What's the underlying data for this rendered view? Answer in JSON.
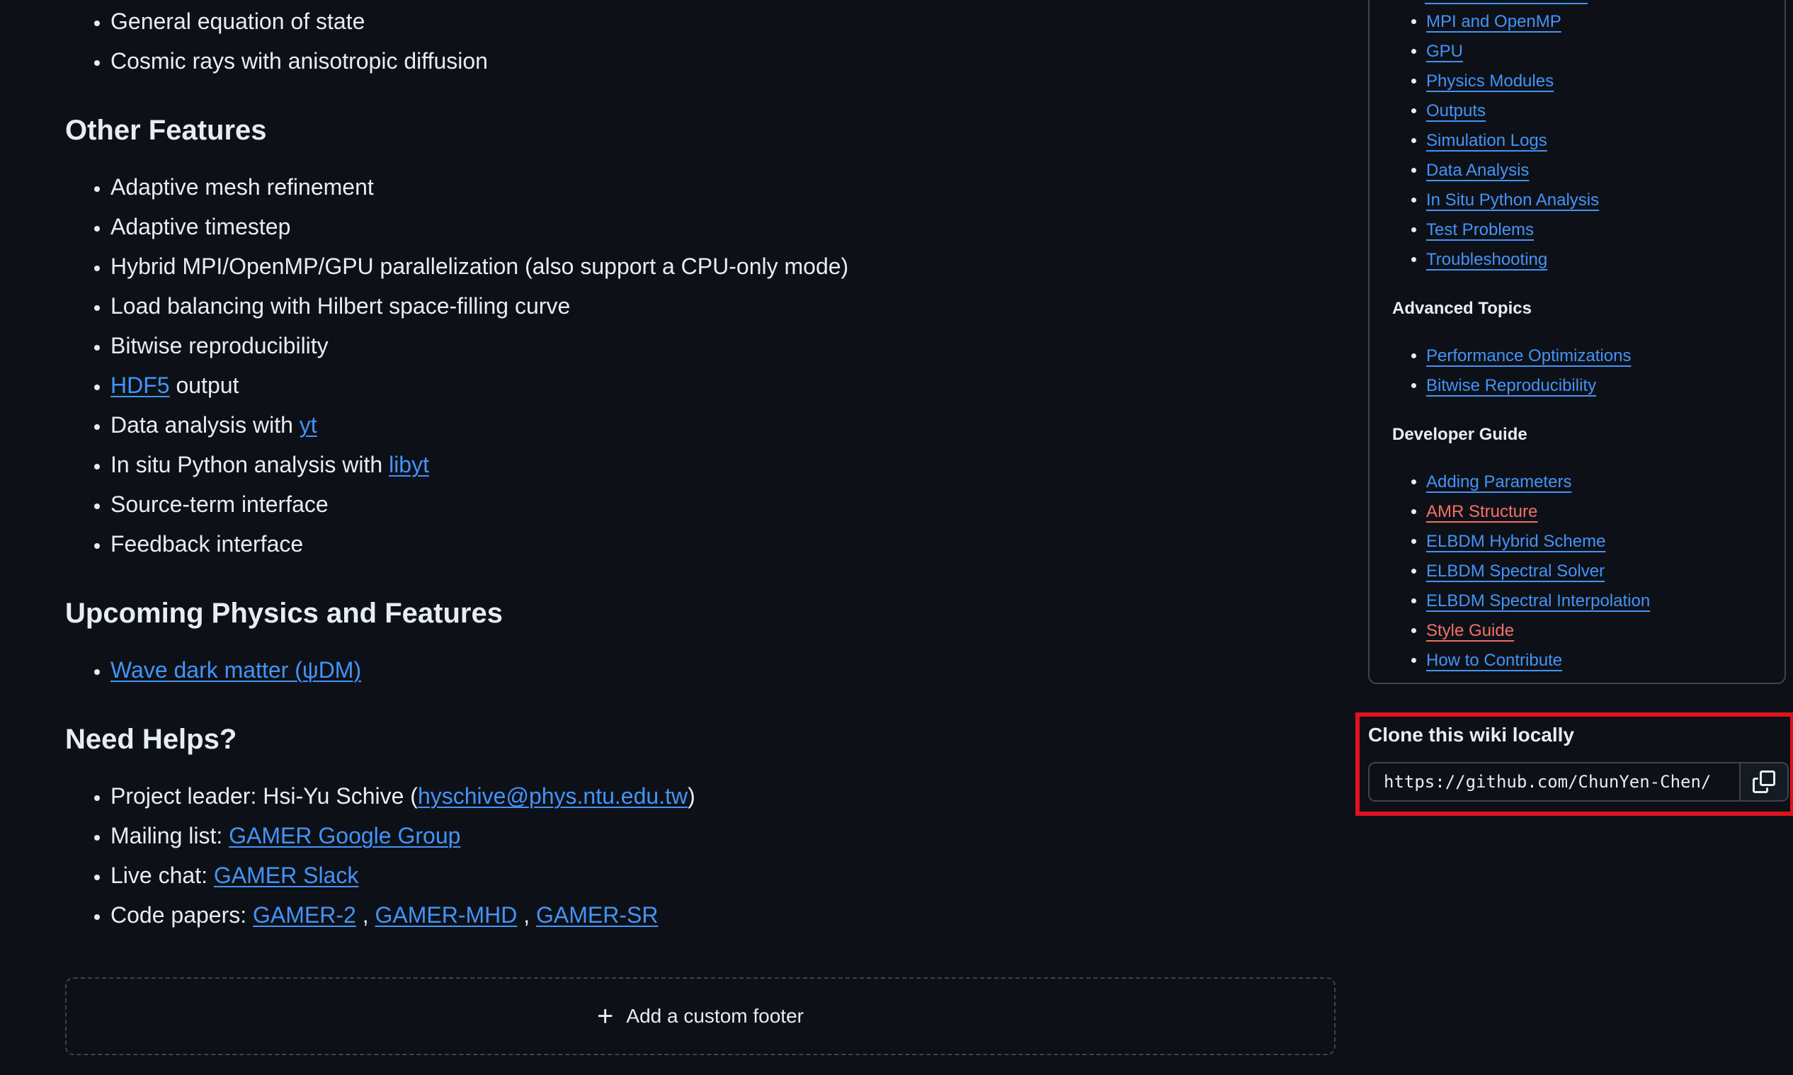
{
  "main": {
    "top_items": [
      "General equation of state",
      "Cosmic rays with anisotropic diffusion"
    ],
    "other_features": {
      "heading": "Other Features",
      "items": {
        "amr": "Adaptive mesh refinement",
        "timestep": "Adaptive timestep",
        "hybrid": "Hybrid MPI/OpenMP/GPU parallelization (also support a CPU-only mode)",
        "load": "Load balancing with Hilbert space-filling curve",
        "bitwise": "Bitwise reproducibility",
        "hdf5_link": "HDF5",
        "hdf5_text": " output",
        "yt_text": "Data analysis with ",
        "yt_link": "yt",
        "libyt_text": "In situ Python analysis with ",
        "libyt_link": "libyt",
        "source": "Source-term interface",
        "feedback": "Feedback interface"
      }
    },
    "upcoming": {
      "heading": "Upcoming Physics and Features",
      "wave_dm": "Wave dark matter (ψDM)"
    },
    "help": {
      "heading": "Need Helps?",
      "leader_prefix": "Project leader: Hsi-Yu Schive (",
      "leader_email": "hyschive@phys.ntu.edu.tw",
      "leader_suffix": ")",
      "mailing_prefix": "Mailing list: ",
      "mailing_link": "GAMER Google Group",
      "chat_prefix": "Live chat: ",
      "chat_link": "GAMER Slack",
      "papers_prefix": "Code papers: ",
      "paper1": "GAMER-2",
      "paper2": "GAMER-MHD",
      "paper3": "GAMER-SR",
      "sep": " , "
    },
    "footer": {
      "plus": "+",
      "label": "Add a custom footer"
    }
  },
  "sidebar": {
    "section1": [
      "MPI and OpenMP",
      "GPU",
      "Physics Modules",
      "Outputs",
      "Simulation Logs",
      "Data Analysis",
      "In Situ Python Analysis",
      "Test Problems",
      "Troubleshooting"
    ],
    "advanced_heading": "Advanced Topics",
    "advanced": [
      "Performance Optimizations",
      "Bitwise Reproducibility"
    ],
    "developer_heading": "Developer Guide",
    "developer": [
      "Adding Parameters",
      "AMR Structure",
      "ELBDM Hybrid Scheme",
      "ELBDM Spectral Solver",
      "ELBDM Spectral Interpolation",
      "Style Guide",
      "How to Contribute"
    ]
  },
  "clone": {
    "title": "Clone this wiki locally",
    "url": "https://github.com/ChunYen-Chen/"
  },
  "colors": {
    "background": "#0d1117",
    "text": "#e6edf3",
    "link": "#4493f8",
    "missing_link": "#f47067",
    "border": "#3d444d",
    "highlight": "#e0121e"
  },
  "icons": {
    "copy": "copy-icon",
    "plus": "plus-icon"
  }
}
